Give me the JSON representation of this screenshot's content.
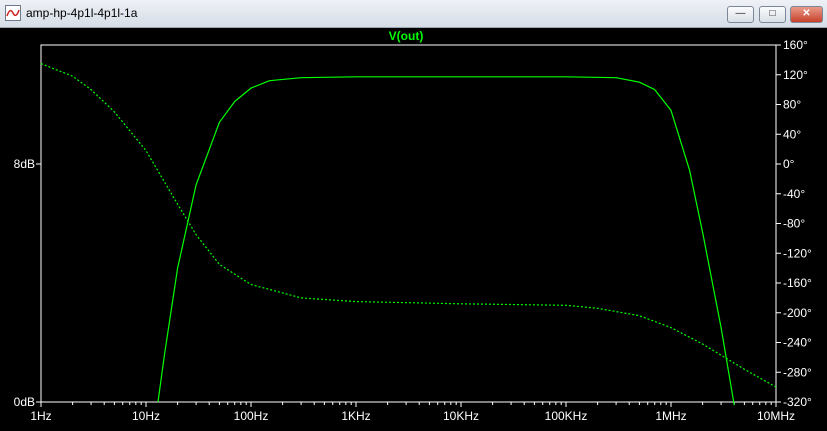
{
  "window": {
    "title": "amp-hp-4p1l-4p1l-1a",
    "minimize_glyph": "—",
    "maximize_glyph": "□",
    "close_glyph": "✕"
  },
  "chart_data": {
    "type": "line",
    "title": "V(out)",
    "x_scale": "log",
    "x_range": [
      1,
      10000000
    ],
    "x_ticks": [
      "1Hz",
      "10Hz",
      "100Hz",
      "1KHz",
      "10KHz",
      "100KHz",
      "1MHz",
      "10MHz"
    ],
    "y_left_ticks": [
      "8dB",
      "0dB"
    ],
    "y_right_ticks": [
      "160°",
      "120°",
      "80°",
      "40°",
      "0°",
      "-40°",
      "-80°",
      "-120°",
      "-160°",
      "-200°",
      "-240°",
      "-280°",
      "-320°"
    ],
    "y_right_range": [
      -320,
      160
    ],
    "grid": false,
    "colors": {
      "background": "#000000",
      "trace": "#00ff00",
      "axis": "#ffffff"
    },
    "series": [
      {
        "name": "V(out)",
        "axis": "left",
        "style": "solid",
        "x": [
          13,
          15,
          20,
          30,
          50,
          70,
          100,
          150,
          300,
          1000,
          10000,
          100000,
          300000,
          500000,
          700000,
          1000000,
          1500000,
          2000000,
          3000000,
          4000000
        ],
        "y": [
          0,
          1.6,
          4.5,
          7.3,
          9.4,
          10.1,
          10.55,
          10.8,
          10.9,
          10.93,
          10.93,
          10.93,
          10.9,
          10.75,
          10.5,
          9.8,
          7.8,
          5.7,
          2.5,
          -0.1
        ]
      },
      {
        "name": "V(out) phase",
        "axis": "right",
        "style": "dotted",
        "x": [
          1,
          2,
          3,
          5,
          10,
          20,
          30,
          50,
          100,
          300,
          1000,
          10000,
          100000,
          200000,
          500000,
          1000000,
          2000000,
          5000000,
          10000000
        ],
        "y": [
          135,
          118,
          100,
          70,
          18,
          -54,
          -95,
          -135,
          -162,
          -180,
          -185,
          -188,
          -190,
          -194,
          -204,
          -220,
          -242,
          -276,
          -300
        ]
      }
    ]
  }
}
